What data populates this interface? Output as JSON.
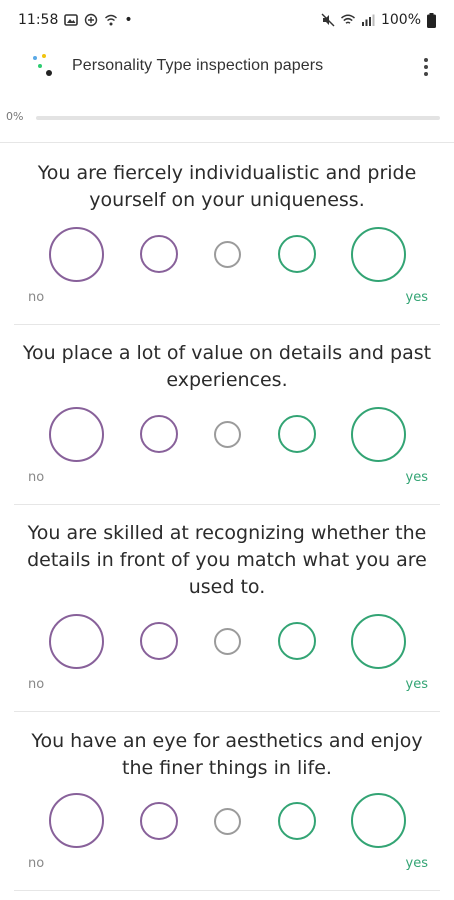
{
  "status_bar": {
    "time": "11:58",
    "dot": "•",
    "battery": "100%",
    "left_icons": [
      "gallery-icon",
      "notification-icon",
      "wifi-call-icon"
    ],
    "right_icons": [
      "mute-icon",
      "wifi-icon",
      "signal-icon",
      "battery-icon"
    ]
  },
  "app_bar": {
    "title": "Personality Type inspection papers",
    "logo_icon": "app-logo-icon",
    "menu_icon": "more-vert-icon"
  },
  "progress": {
    "label": "0%",
    "value": 0
  },
  "scale": {
    "no_label": "no",
    "yes_label": "yes",
    "colors": {
      "agree": "#33a474",
      "neutral": "#9b9b9b",
      "disagree": "#88619a"
    }
  },
  "questions": [
    {
      "line1": "You are fiercely individualistic and pride",
      "line2": "yourself on your uniqueness.",
      "line3": ""
    },
    {
      "line1": "You place a lot of value on details and past",
      "line2": "experiences.",
      "line3": ""
    },
    {
      "line1": "You are skilled at recognizing whether the",
      "line2": "details in front of you match what you are",
      "line3": "used to."
    },
    {
      "line1": "You have an eye for aesthetics and enjoy",
      "line2": "the finer things in life.",
      "line3": ""
    }
  ]
}
